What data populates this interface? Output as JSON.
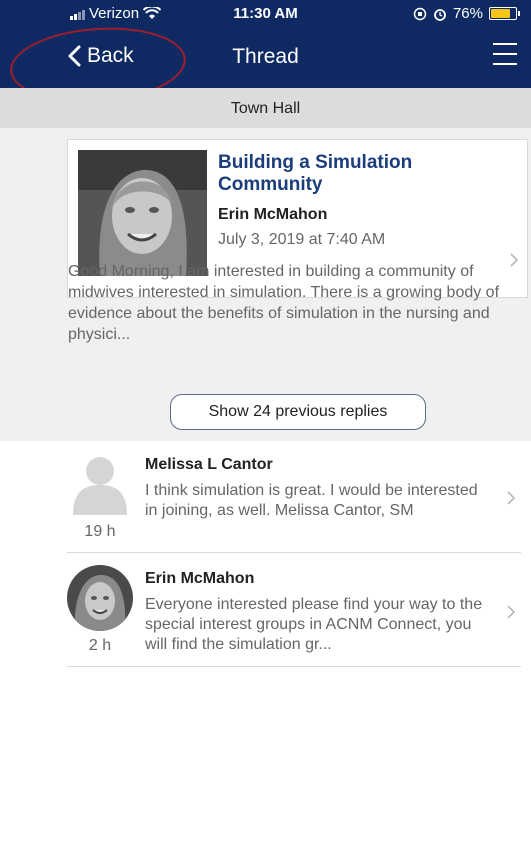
{
  "status": {
    "carrier": "Verizon",
    "time": "11:30 AM",
    "battery": "76%",
    "battery_level": 0.76
  },
  "nav": {
    "back_label": "Back",
    "title": "Thread"
  },
  "section": "Town Hall",
  "thread": {
    "title": "Building a Simulation Community",
    "author": "Erin McMahon",
    "date": "July 3, 2019 at 7:40 AM",
    "excerpt": "Good Morning, I am interested in building a community of midwives interested in simulation.  There is a growing body of evidence about the benefits of simulation in the nursing and physici..."
  },
  "show_previous_label": "Show 24 previous replies",
  "replies": [
    {
      "name": "Melissa L Cantor",
      "text": "I think simulation is great.  I would be interested in joining, as well.  Melissa Cantor, SM",
      "ago": "19 h",
      "avatar": "default-person-icon"
    },
    {
      "name": "Erin McMahon",
      "text": "Everyone interested please find your way to the special interest groups in ACNM Connect, you will find the simulation gr...",
      "ago": "2 h",
      "avatar": "photo"
    }
  ],
  "colors": {
    "header": "#0f2a63",
    "title": "#1b3d7a",
    "annotation": "#a11d2a"
  }
}
